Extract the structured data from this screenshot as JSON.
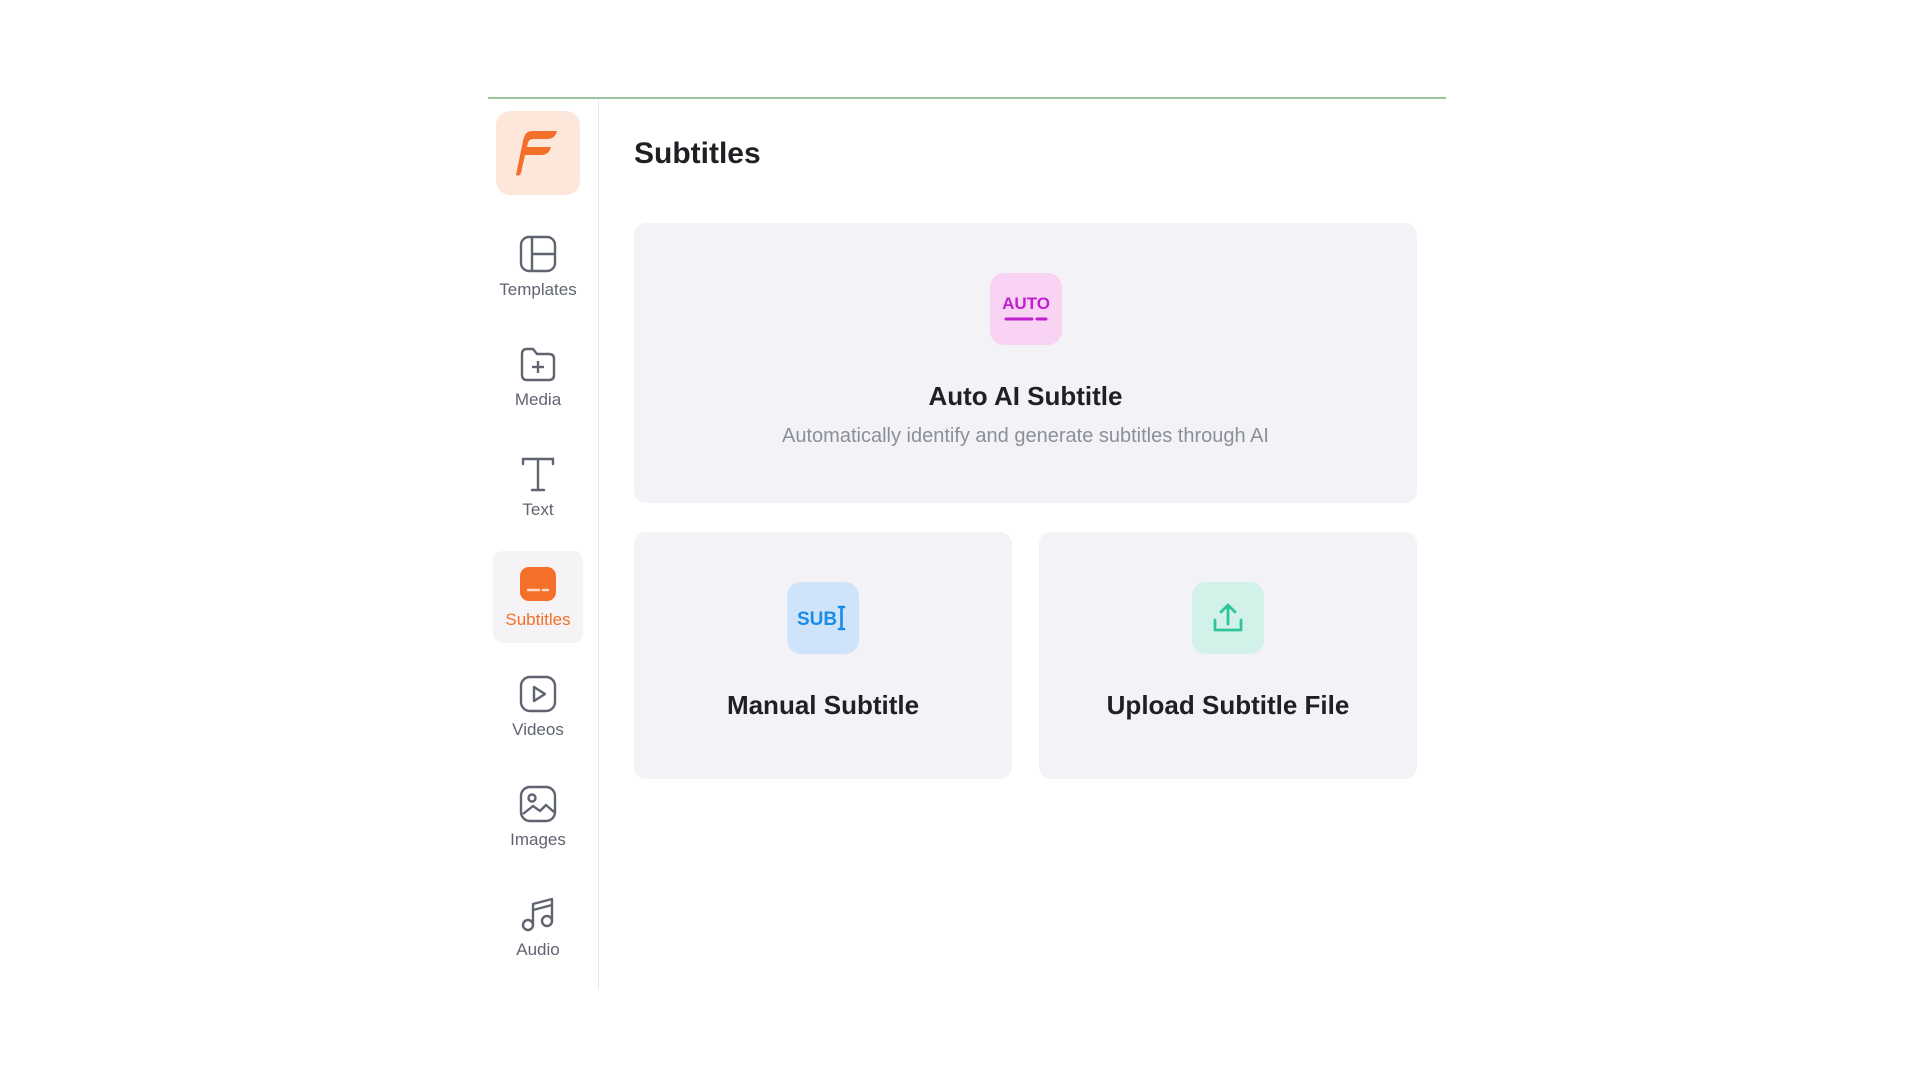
{
  "sidebar": {
    "logo": {
      "icon": "brand-f-logo",
      "color": "#f36f2a",
      "background": "#fde7da"
    },
    "items": [
      {
        "label": "Templates",
        "icon": "templates-icon",
        "active": false
      },
      {
        "label": "Media",
        "icon": "folder-plus-icon",
        "active": false
      },
      {
        "label": "Text",
        "icon": "text-t-icon",
        "active": false
      },
      {
        "label": "Subtitles",
        "icon": "subtitles-icon",
        "active": true
      },
      {
        "label": "Videos",
        "icon": "video-play-icon",
        "active": false
      },
      {
        "label": "Images",
        "icon": "image-icon",
        "active": false
      },
      {
        "label": "Audio",
        "icon": "music-note-icon",
        "active": false
      }
    ]
  },
  "main": {
    "title": "Subtitles",
    "cards": {
      "auto": {
        "title": "Auto AI Subtitle",
        "description": "Automatically identify and generate subtitles through AI",
        "icon_text": "AUTO",
        "icon": "auto-subtitle-icon",
        "accent": "#c01fd0"
      },
      "manual": {
        "title": "Manual Subtitle",
        "icon_text": "SUB",
        "icon": "manual-subtitle-icon",
        "accent": "#1b8be8"
      },
      "upload": {
        "title": "Upload Subtitle File",
        "icon": "upload-icon",
        "accent": "#2fc59c"
      }
    }
  },
  "colors": {
    "active_accent": "#f36f2a",
    "frame_top_border": "#9bc49c",
    "card_bg": "#f3f3f7"
  }
}
